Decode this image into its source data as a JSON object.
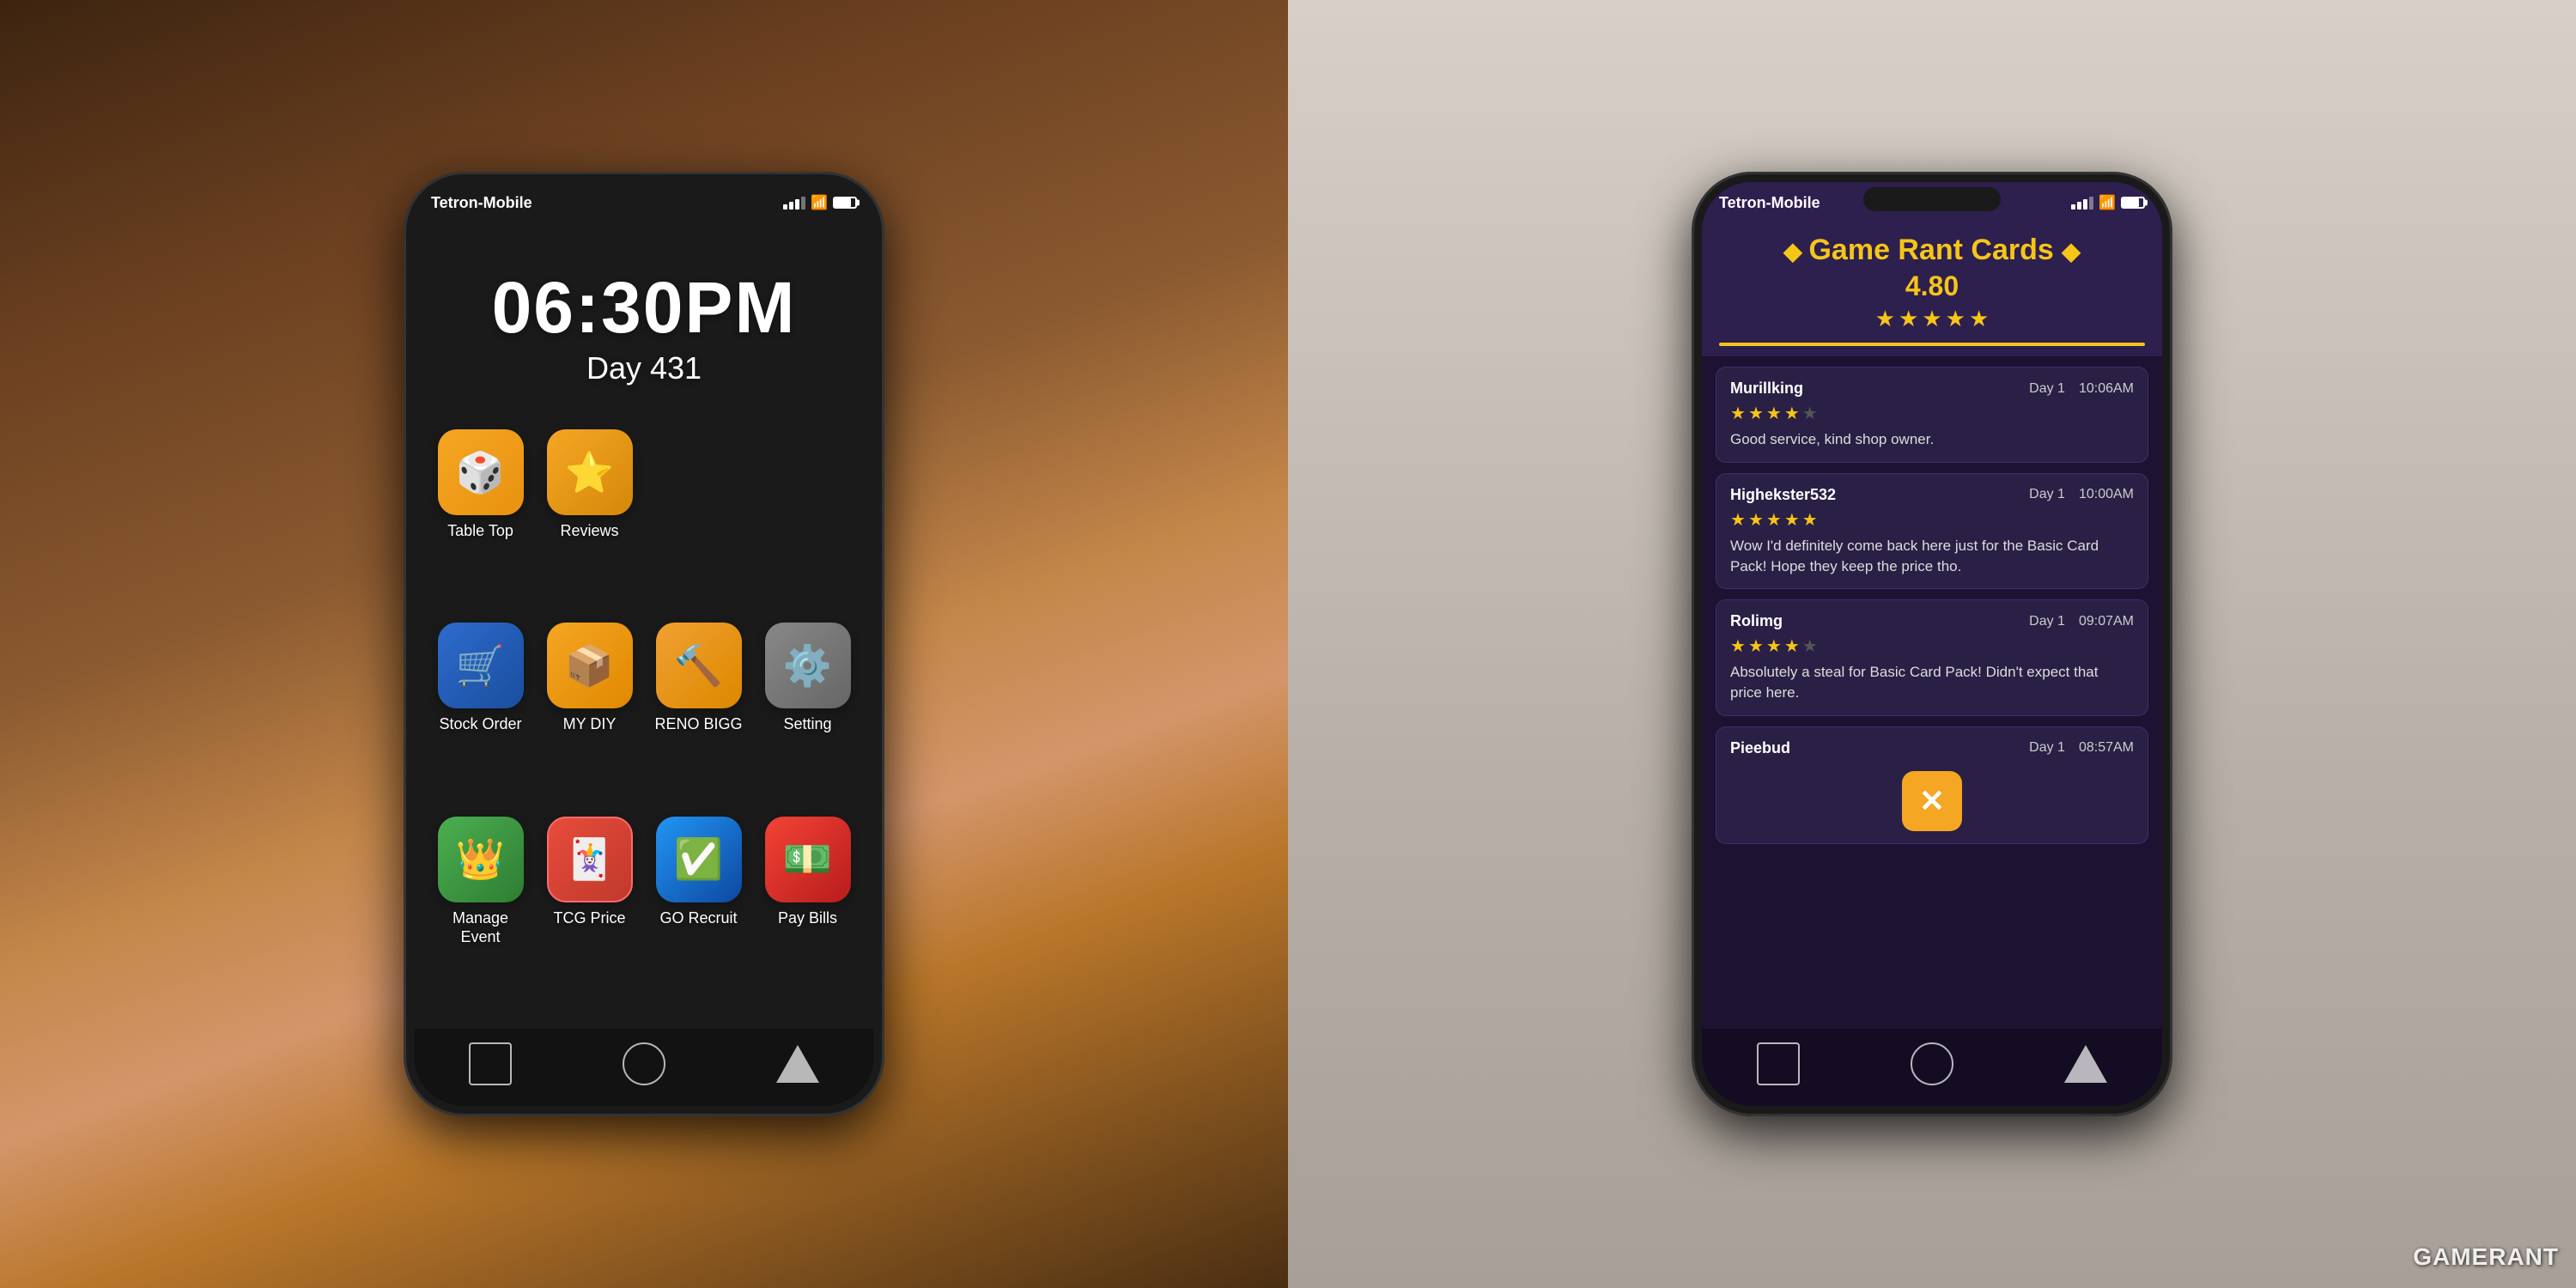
{
  "left_phone": {
    "status_bar": {
      "carrier": "Tetron-Mobile",
      "signal": "●●●",
      "wifi": "wifi",
      "battery": "battery"
    },
    "time": "06:30PM",
    "day": "Day 431",
    "apps": [
      {
        "id": "tabletop",
        "label": "Table Top",
        "icon": "🎲",
        "color": "tabletop"
      },
      {
        "id": "reviews",
        "label": "Reviews",
        "icon": "⭐",
        "color": "reviews"
      },
      {
        "id": "stockorder",
        "label": "Stock Order",
        "icon": "🛒",
        "color": "stockorder"
      },
      {
        "id": "mydiy",
        "label": "MY DIY",
        "icon": "📦",
        "color": "mydiy"
      },
      {
        "id": "renobigg",
        "label": "RENO BIGG",
        "icon": "🔨",
        "color": "renobigg"
      },
      {
        "id": "setting",
        "label": "Setting",
        "icon": "⚙️",
        "color": "setting"
      },
      {
        "id": "manageevent",
        "label": "Manage Event",
        "icon": "👑",
        "color": "manageevent"
      },
      {
        "id": "tcgprice",
        "label": "TCG Price",
        "icon": "🃏",
        "color": "tcgprice"
      },
      {
        "id": "gorecruit",
        "label": "GO Recruit",
        "icon": "✅",
        "color": "gorecruit"
      },
      {
        "id": "paybills",
        "label": "Pay Bills",
        "icon": "💵",
        "color": "paybills"
      }
    ],
    "bottom_buttons": [
      "square",
      "circle",
      "triangle"
    ]
  },
  "right_phone": {
    "status_bar": {
      "carrier": "Tetron-Mobile",
      "signal": "●●●",
      "wifi": "wifi",
      "battery": "battery"
    },
    "title": "Game Rant Cards",
    "rating_number": "4.80",
    "rating_stars": 4.8,
    "reviews": [
      {
        "username": "Murillking",
        "day": "Day 1",
        "time": "10:06AM",
        "stars": 4,
        "text": "Good service, kind shop owner."
      },
      {
        "username": "Highekster532",
        "day": "Day 1",
        "time": "10:00AM",
        "stars": 5,
        "text": "Wow I'd definitely come back here just for the Basic Card Pack! Hope they keep the price tho."
      },
      {
        "username": "Rolimg",
        "day": "Day 1",
        "time": "09:07AM",
        "stars": 4,
        "text": "Absolutely a steal for Basic Card Pack! Didn't expect that price here."
      },
      {
        "username": "Pieebud",
        "day": "Day 1",
        "time": "08:57AM",
        "stars": 0,
        "text": ""
      }
    ],
    "close_button": "✕",
    "bottom_buttons": [
      "square",
      "circle",
      "triangle"
    ]
  },
  "watermark": "GAMERANT"
}
